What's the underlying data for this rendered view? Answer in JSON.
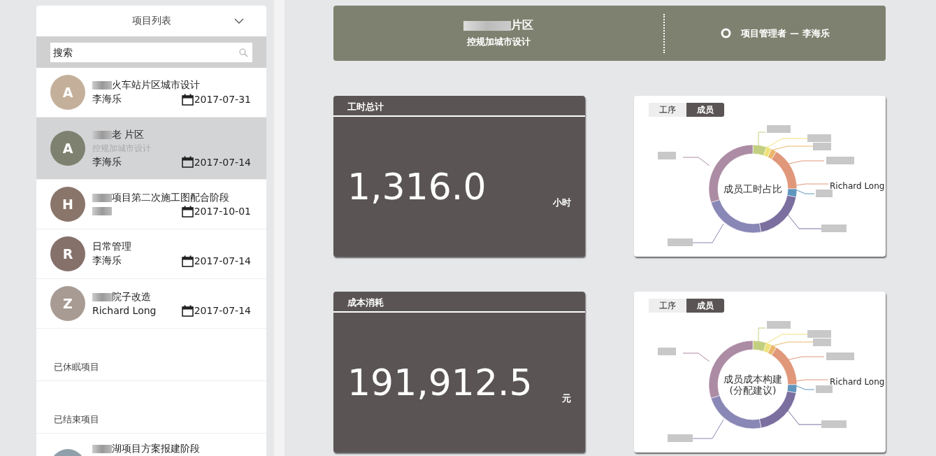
{
  "sidebar": {
    "title": "项目列表",
    "search": {
      "placeholder": "搜索"
    },
    "projects": [
      {
        "avatar": "A",
        "color": "#c4b09a",
        "name": "火车站片区城市设计",
        "name_blurred": true,
        "owner": "李海乐",
        "date": "2017-07-31",
        "selected": false
      },
      {
        "avatar": "A",
        "color": "#7f8170",
        "name": "老 片区",
        "name_blurred": true,
        "subtitle": "控规加城市设计",
        "owner": "李海乐",
        "date": "2017-07-14",
        "selected": true
      },
      {
        "avatar": "H",
        "color": "#8a756b",
        "name": "项目第二次施工图配合阶段",
        "name_blurred": true,
        "owner_blurred": true,
        "date": "2017-10-01",
        "selected": false
      },
      {
        "avatar": "R",
        "color": "#85706a",
        "name": "日常管理",
        "name_blurred": false,
        "owner": "李海乐",
        "date": "2017-07-14",
        "selected": false
      },
      {
        "avatar": "Z",
        "color": "#a89b93",
        "name": "院子改造",
        "name_blurred": true,
        "owner": "Richard Long",
        "date": "2017-07-14",
        "selected": false
      }
    ],
    "sections": [
      {
        "title": "已休眠项目"
      },
      {
        "title": "已结束项目",
        "projects": [
          {
            "color": "#8fa0aa",
            "name": "湖项目方案报建阶段",
            "name_blurred": true,
            "selected": false
          }
        ]
      }
    ]
  },
  "header": {
    "title": "片区",
    "title_blurred": true,
    "subtitle": "控规加城市设计",
    "manager": "项目管理者 — 李海乐"
  },
  "stats": [
    {
      "title": "工时总计",
      "value": "1,316.0",
      "unit": "小时",
      "chart": {
        "tabs": [
          {
            "label": "工序",
            "selected": false
          },
          {
            "label": "成员",
            "selected": true
          }
        ],
        "center_title": [
          "成员工时占比"
        ],
        "label": "Richard Long"
      }
    },
    {
      "title": "成本消耗",
      "value": "191,912.5",
      "unit": "元",
      "chart": {
        "tabs": [
          {
            "label": "工序",
            "selected": false
          },
          {
            "label": "成员",
            "selected": true
          }
        ],
        "center_title": [
          "成员成本构建",
          "(分配建议)"
        ],
        "label": "Richard Long"
      }
    }
  ]
}
